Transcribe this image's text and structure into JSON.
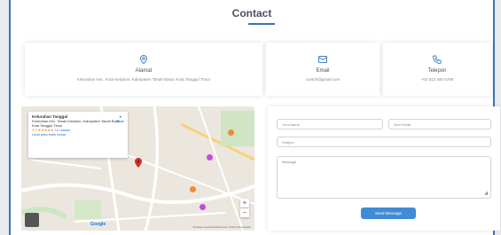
{
  "section": {
    "title": "Contact"
  },
  "cards": {
    "address": {
      "icon": "map-pin-icon",
      "label": "Alamat",
      "value": "Kelurahan Kec. Kota Kedaton, Kabupaten Tanah Barat, Kota Tanggul Timur"
    },
    "email": {
      "icon": "envelope-icon",
      "label": "Email",
      "value": "contoh@gmail.com"
    },
    "phone": {
      "icon": "phone-icon",
      "label": "Telepon",
      "value": "+62 812 345 6789"
    }
  },
  "map": {
    "place_name": "Kelurahan Tanggul",
    "place_address": "Kelurahan Kec. Tanah Kedaton, Kabupaten Tanah Barat, Kota Tanggul Timur",
    "rating": "4.5 ★★★★★",
    "reviews": "12 ulasan",
    "larger_map": "Lihat peta lebih besar",
    "directions": "Rute",
    "google": "Google",
    "terms": "Pintasan keyboard  Data peta ©2024  Persyaratan",
    "zoom_in": "+",
    "zoom_out": "−",
    "accent_pin": "#d93025",
    "accent_poi": "#c64bd8"
  },
  "form": {
    "first_name_placeholder": "Your Name",
    "last_name_placeholder": "Your Email",
    "subject_placeholder": "Subject",
    "message_placeholder": "Message",
    "submit_label": "Send Message",
    "accent": "#3f8bd6"
  }
}
